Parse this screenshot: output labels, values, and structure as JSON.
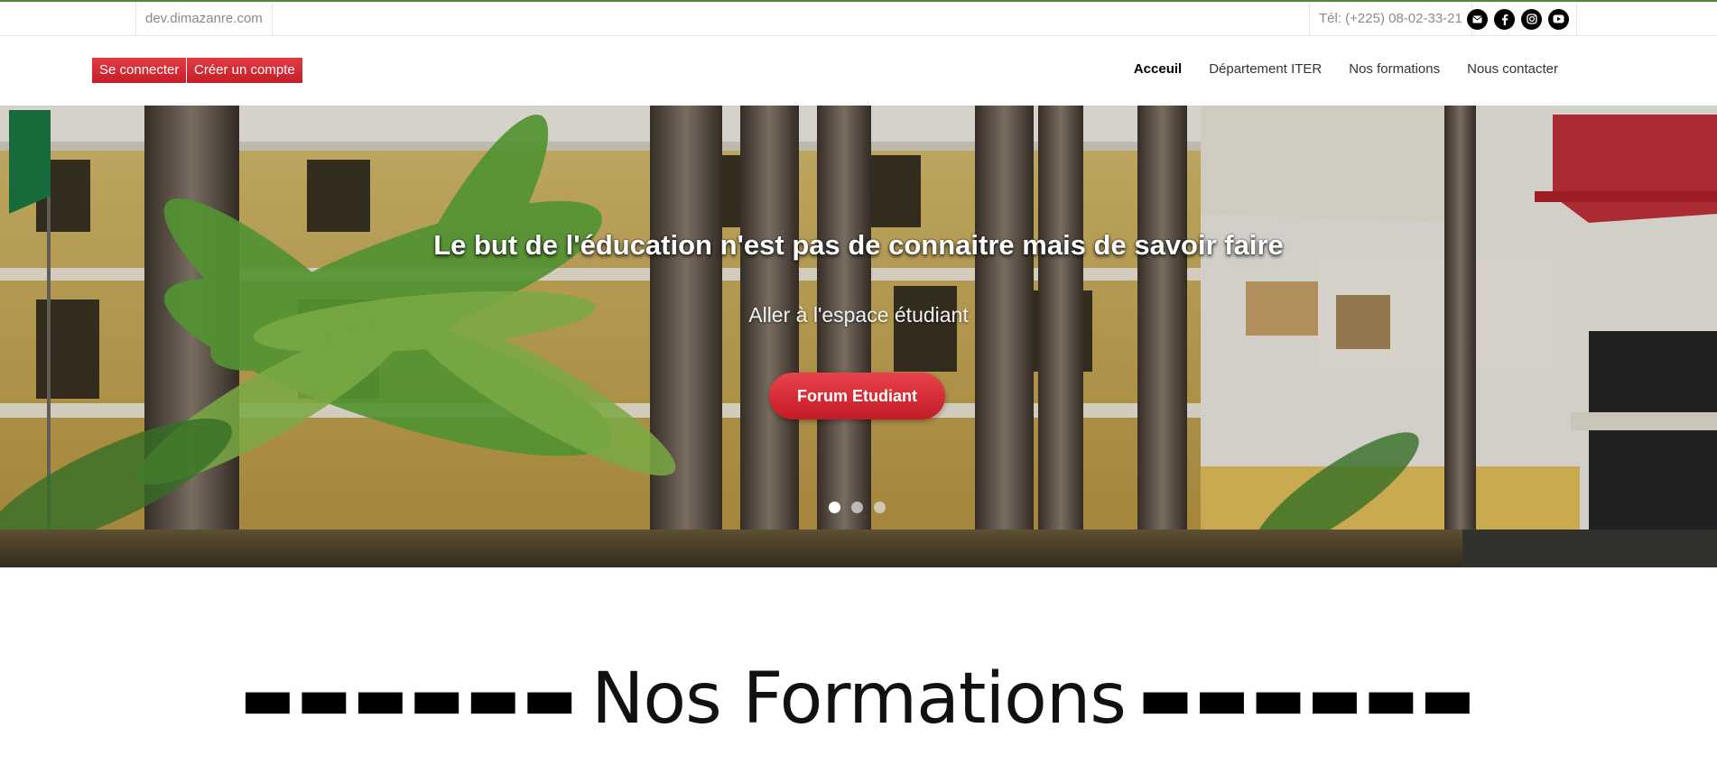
{
  "topbar": {
    "domain": "dev.dimazanre.com",
    "phone": "Tél: (+225) 08-02-33-21",
    "socials": [
      {
        "icon": "mail-icon"
      },
      {
        "icon": "facebook-icon"
      },
      {
        "icon": "instagram-icon"
      },
      {
        "icon": "youtube-icon"
      }
    ]
  },
  "auth": {
    "login": "Se connecter",
    "register": "Créer un compte"
  },
  "nav": {
    "items": [
      {
        "label": "Acceuil"
      },
      {
        "label": "Département ITER"
      },
      {
        "label": "Nos formations"
      },
      {
        "label": "Nous contacter"
      }
    ]
  },
  "hero": {
    "title": "Le but de l'éducation n'est pas de connaitre mais de savoir faire",
    "subtitle": "Aller à l'espace étudiant",
    "cta": "Forum Etudiant",
    "slides": 3,
    "active_slide": 1
  },
  "section": {
    "left_dashes": "▬▬▬▬▬▬",
    "title": "Nos Formations",
    "right_dashes": "▬▬▬▬▬▬"
  },
  "colors": {
    "accent_red": "#d62a33",
    "topbar_border": "#4a8a3a"
  }
}
